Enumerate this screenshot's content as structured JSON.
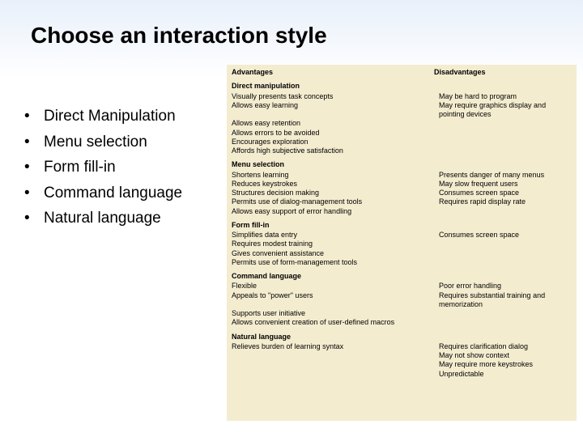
{
  "title": "Choose an interaction style",
  "bullets": [
    "Direct Manipulation",
    "Menu selection",
    "Form fill-in",
    "Command language",
    "Natural language"
  ],
  "table": {
    "headers": [
      "Advantages",
      "Disadvantages"
    ],
    "groups": [
      {
        "name": "Direct manipulation",
        "rows": [
          {
            "a": "Visually presents task concepts",
            "d": "May be hard to program"
          },
          {
            "a": "Allows easy learning",
            "d": "May require graphics display and pointing devices"
          },
          {
            "a": "Allows easy retention",
            "d": ""
          },
          {
            "a": "Allows errors to be avoided",
            "d": ""
          },
          {
            "a": "Encourages exploration",
            "d": ""
          },
          {
            "a": "Affords high subjective satisfaction",
            "d": ""
          }
        ]
      },
      {
        "name": "Menu selection",
        "rows": [
          {
            "a": "Shortens learning",
            "d": "Presents danger of many menus"
          },
          {
            "a": "Reduces keystrokes",
            "d": "May slow frequent users"
          },
          {
            "a": "Structures decision making",
            "d": "Consumes screen space"
          },
          {
            "a": "Permits use of dialog-management tools",
            "d": "Requires rapid display rate"
          },
          {
            "a": "Allows easy support of error handling",
            "d": ""
          }
        ]
      },
      {
        "name": "Form fill-in",
        "rows": [
          {
            "a": "Simplifies data entry",
            "d": "Consumes screen space"
          },
          {
            "a": "Requires modest training",
            "d": ""
          },
          {
            "a": "Gives convenient assistance",
            "d": ""
          },
          {
            "a": "Permits use of form-management tools",
            "d": ""
          }
        ]
      },
      {
        "name": "Command language",
        "rows": [
          {
            "a": "Flexible",
            "d": "Poor error handling"
          },
          {
            "a": "Appeals to \"power\" users",
            "d": "Requires substantial training and memorization"
          },
          {
            "a": "",
            "d": ""
          },
          {
            "a": "Supports user initiative",
            "d": ""
          },
          {
            "a": "Allows convenient creation of user-defined macros",
            "d": ""
          }
        ]
      },
      {
        "name": "Natural language",
        "rows": [
          {
            "a": "Relieves burden of learning syntax",
            "d": "Requires clarification dialog"
          },
          {
            "a": "",
            "d": "May not show context"
          },
          {
            "a": "",
            "d": "May require more keystrokes"
          },
          {
            "a": "",
            "d": "Unpredictable"
          }
        ]
      }
    ]
  }
}
